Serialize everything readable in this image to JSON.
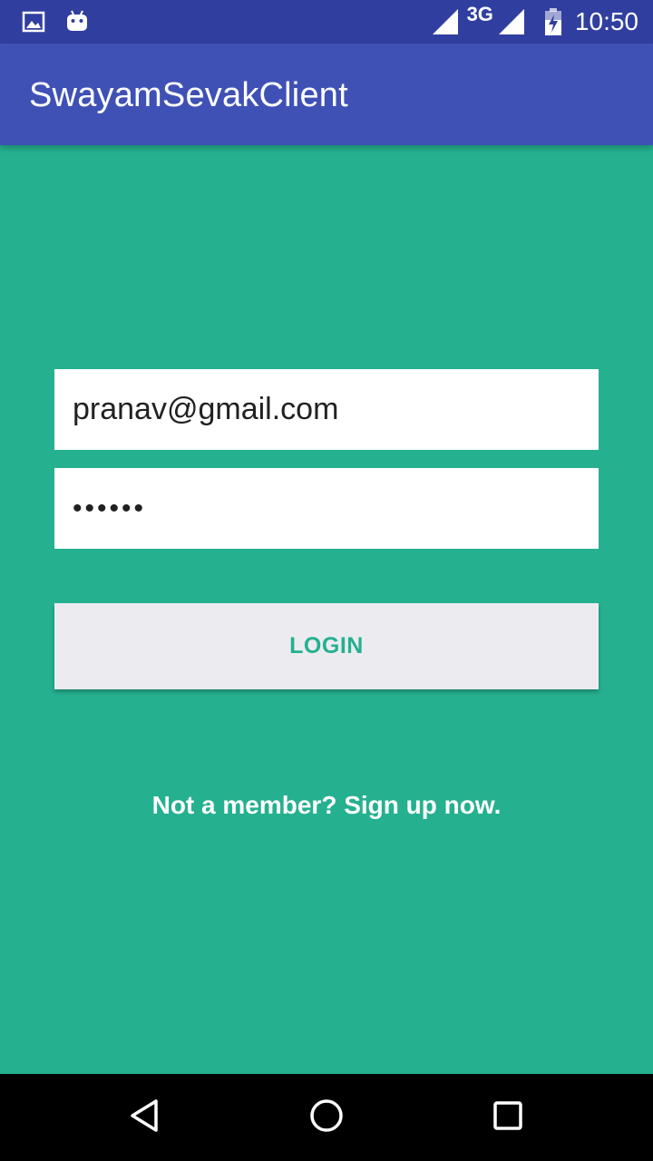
{
  "status_bar": {
    "network_type": "3G",
    "time": "10:50",
    "icons": [
      "image-icon",
      "android-icon",
      "signal-icon",
      "signal-icon",
      "battery-charging-icon"
    ]
  },
  "app_bar": {
    "title": "SwayamSevakClient"
  },
  "login_form": {
    "email_value": "pranav@gmail.com",
    "password_value": "••••••",
    "login_label": "LOGIN",
    "signup_text": "Not a member? Sign up now."
  },
  "nav_bar": {
    "icons": [
      "back-icon",
      "home-icon",
      "recents-icon"
    ]
  },
  "colors": {
    "status_bar": "#303f9f",
    "app_bar": "#3f51b5",
    "background": "#25b090",
    "button": "#ececf0",
    "button_text": "#25b090"
  }
}
